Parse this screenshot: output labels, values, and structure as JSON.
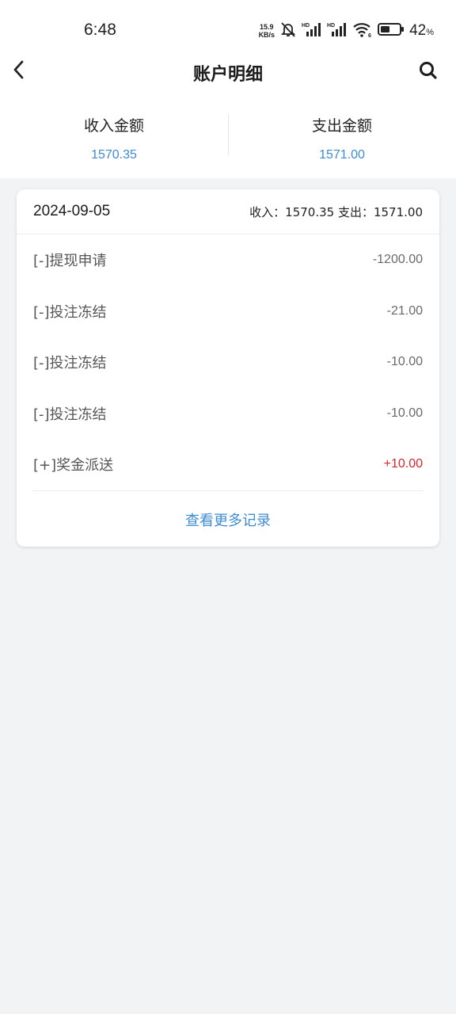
{
  "status_bar": {
    "time": "6:48",
    "net_speed_value": "15.9",
    "net_speed_unit": "KB/s",
    "battery_percent": "42",
    "battery_unit": "%"
  },
  "header": {
    "title": "账户明细",
    "back_icon": "chevron-left-icon",
    "search_icon": "search-icon"
  },
  "summary": {
    "income_label": "收入金额",
    "income_value": "1570.35",
    "expense_label": "支出金额",
    "expense_value": "1571.00"
  },
  "day_card": {
    "date": "2024-09-05",
    "totals": "收入：1570.35 支出：1571.00",
    "records": [
      {
        "label": "[-]提现申请",
        "amount": "-1200.00"
      },
      {
        "label": "[-]投注冻结",
        "amount": "-21.00"
      },
      {
        "label": "[-]投注冻结",
        "amount": "-10.00"
      },
      {
        "label": "[-]投注冻结",
        "amount": "-10.00"
      },
      {
        "label": "[+]奖金派送",
        "amount": "+10.00"
      }
    ],
    "more_label": "查看更多记录"
  },
  "colors": {
    "accent": "#3f8bd1",
    "positive_amount": "#d8262b",
    "background": "#f2f3f5"
  }
}
